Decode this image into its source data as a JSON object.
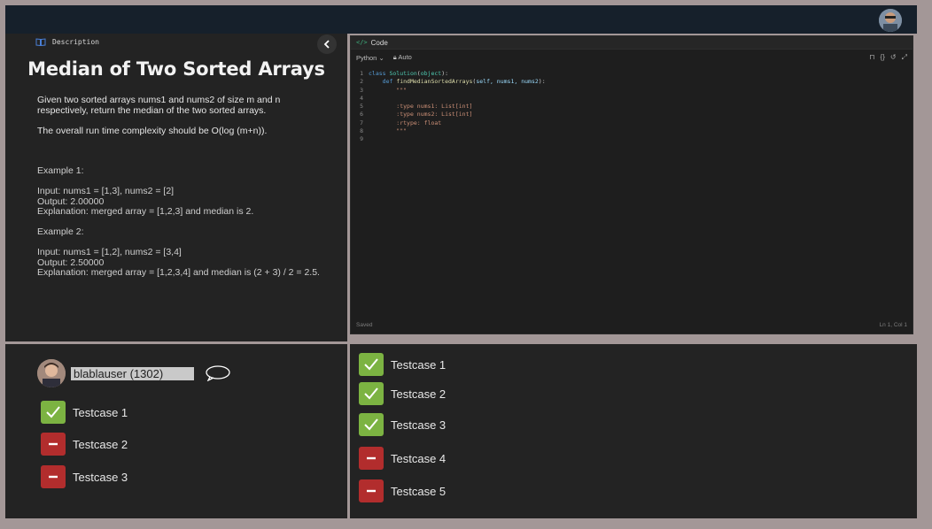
{
  "description_panel": {
    "header": "Description",
    "title": "Median of Two Sorted Arrays",
    "paragraphs": [
      "Given two sorted arrays nums1 and nums2 of size m and n respectively, return the median of the two sorted arrays.",
      "The overall run time complexity should be O(log (m+n))."
    ],
    "examples": [
      {
        "label": "Example 1:",
        "lines": [
          "Input: nums1 = [1,3], nums2 = [2]",
          "Output: 2.00000",
          "Explanation: merged array = [1,2,3] and median is 2."
        ]
      },
      {
        "label": "Example 2:",
        "lines": [
          "Input: nums1 = [1,2], nums2 = [3,4]",
          "Output: 2.50000",
          "Explanation: merged array = [1,2,3,4] and median is (2 + 3) / 2 = 2.5."
        ]
      }
    ]
  },
  "code_panel": {
    "tab": "Code",
    "tag": "</>",
    "language": "Python",
    "mode": "Auto",
    "status_left": "Saved",
    "status_right": "Ln 1, Col 1",
    "code_lines": [
      [
        "class ",
        "Solution",
        "(",
        "object",
        "):"
      ],
      [
        "    def ",
        "findMedianSortedArrays",
        "(",
        "self, nums1, nums2",
        "):"
      ],
      [
        "        \"\"\""
      ],
      [
        ""
      ],
      [
        "        :type nums1: List[int]"
      ],
      [
        "        :type nums2: List[int]"
      ],
      [
        "        :rtype: float"
      ],
      [
        "        \"\"\""
      ],
      [
        ""
      ]
    ]
  },
  "players_panel": {
    "username": "blablauser (1302)",
    "testcases": [
      {
        "label": "Testcase 1",
        "status": "pass"
      },
      {
        "label": "Testcase 2",
        "status": "fail"
      },
      {
        "label": "Testcase 3",
        "status": "fail"
      }
    ]
  },
  "tests_panel": {
    "testcases": [
      {
        "label": "Testcase 1",
        "status": "pass"
      },
      {
        "label": "Testcase 2",
        "status": "pass"
      },
      {
        "label": "Testcase 3",
        "status": "pass"
      },
      {
        "label": "Testcase 4",
        "status": "fail"
      },
      {
        "label": "Testcase 5",
        "status": "fail"
      }
    ]
  },
  "icons": {
    "book": "book-icon",
    "collapse": "chevron-left-icon",
    "bookmark": "bookmark-icon",
    "braces": "braces-icon",
    "reset": "reset-icon",
    "expand": "expand-icon",
    "chat": "chat-bubble-icon",
    "pass": "check-icon",
    "fail": "minus-icon"
  },
  "colors": {
    "pass": "#7cb342",
    "fail": "#b22d2d",
    "topbar": "#16202b",
    "panel": "#232323"
  }
}
